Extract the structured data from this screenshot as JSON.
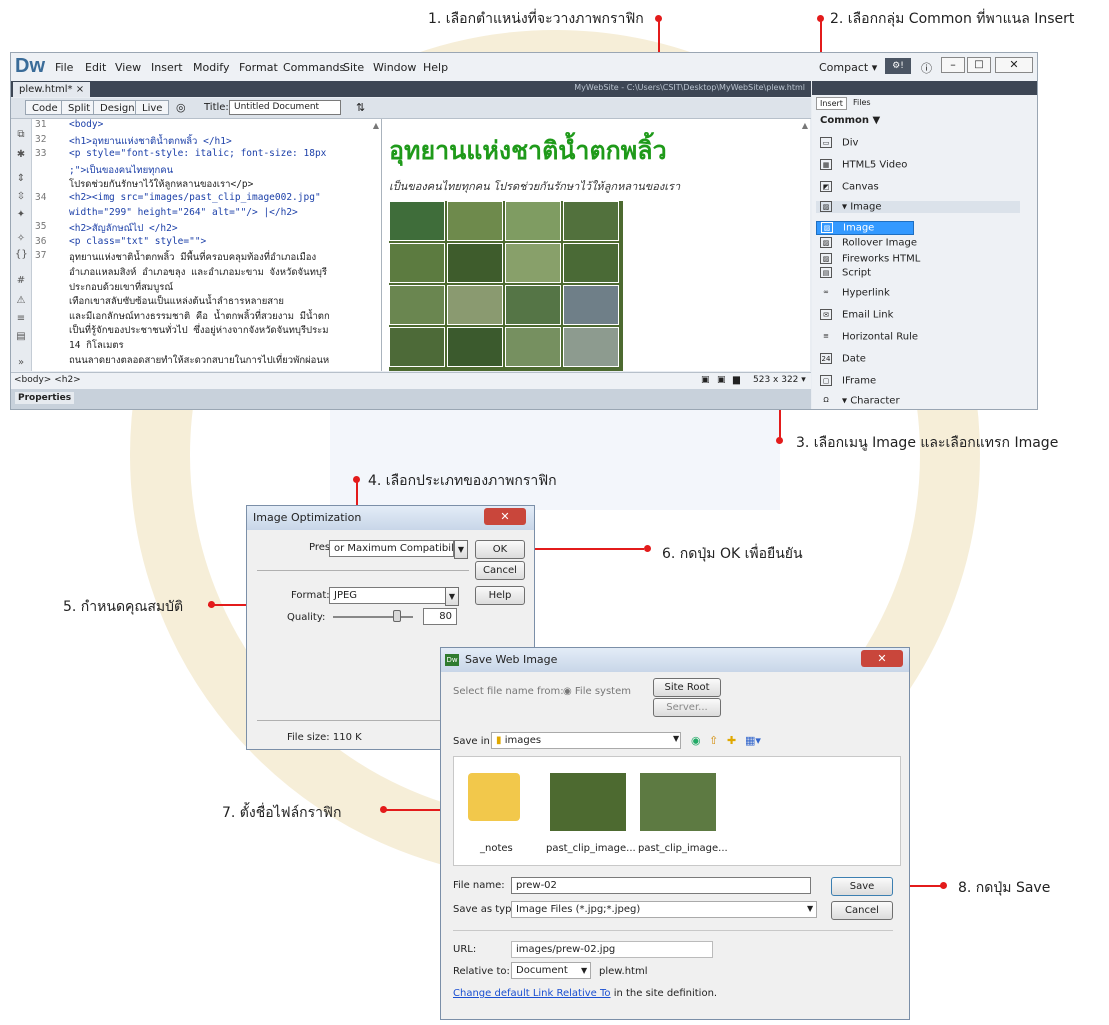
{
  "annotations": {
    "a1": "1. เลือกตำแหน่งที่จะวางภาพกราฟิก",
    "a2": "2. เลือกกลุ่ม Common ที่พาแนล Insert",
    "a3": "3. เลือกเมนู Image และเลือกแทรก Image",
    "a4": "4. เลือกประเภทของภาพกราฟิก",
    "a5": "5. กำหนดคุณสมบัติ",
    "a6": "6. กดปุ่ม OK เพื่อยืนยัน",
    "a7": "7. ตั้งชื่อไฟล์กราฟิก",
    "a8": "8. กดปุ่ม Save"
  },
  "dw": {
    "logo": "Dw",
    "menus": [
      "File",
      "Edit",
      "View",
      "Insert",
      "Modify",
      "Format",
      "Commands",
      "Site",
      "Window",
      "Help"
    ],
    "workspace": "Compact",
    "doc_tab": "plew.html*",
    "path": "MyWebSite - C:\\Users\\CSIT\\Desktop\\MyWebSite\\plew.html",
    "toolbar": {
      "code": "Code",
      "split": "Split",
      "design": "Design",
      "live": "Live",
      "title_label": "Title:",
      "title_value": "Untitled Document"
    },
    "code_lines": [
      {
        "n": "31",
        "t": "<body>"
      },
      {
        "n": "32",
        "t": "<h1>อุทยานแห่งชาติน้ำตกพลิ้ว  </h1>"
      },
      {
        "n": "33",
        "t": "<p style=\"font-style: italic; font-size: 18px"
      },
      {
        "n": "",
        "t": ";\">เป็นของคนไทยทุกคน"
      },
      {
        "n": "",
        "t": "โปรดช่วยกันรักษาไว้ให้ลูกหลานของเรา</p>"
      },
      {
        "n": "34",
        "t": "<h2><img src=\"images/past_clip_image002.jpg\""
      },
      {
        "n": "",
        "t": "width=\"299\" height=\"264\"  alt=\"\"/> |</h2>"
      },
      {
        "n": "35",
        "t": "<h2>สัญลักษณ์ไป </h2>"
      },
      {
        "n": "36",
        "t": "<p class=\"txt\" style=\"\">"
      },
      {
        "n": "37",
        "t": "อุทยานแห่งชาติน้ำตกพลิ้ว มีพื้นที่ครอบคลุมท้องที่อำเภอเมือง"
      },
      {
        "n": "",
        "t": "อำเภอแหลมสิงห์ อำเภอขลุง และอำเภอมะขาม จังหวัดจันทบุรี"
      },
      {
        "n": "",
        "t": "ประกอบด้วยเขาที่สมบูรณ์"
      },
      {
        "n": "",
        "t": "เทือกเขาสลับซับซ้อนเป็นแหล่งต้นน้ำลำธารหลายสาย"
      },
      {
        "n": "",
        "t": "และมีเอกลักษณ์ทางธรรมชาติ คือ น้ำตกพลิ้วที่สวยงาม มีน้ำตก"
      },
      {
        "n": "",
        "t": "เป็นที่รู้จักของประชาชนทั่วไป ซึ่งอยู่ห่างจากจังหวัดจันทบุรีประม"
      },
      {
        "n": "",
        "t": "14 กิโลเมตร"
      },
      {
        "n": "",
        "t": "ถนนลาดยางตลอดสายทำให้สะดวกสบายในการไปเที่ยวพักผ่อนห"
      }
    ],
    "design": {
      "heading": "อุทยานแห่งชาติน้ำตกพลิ้ว",
      "subtitle": "เป็นของคนไทยทุกคน โปรดช่วยกันรักษาไว้ให้ลูกหลานของเรา"
    },
    "status": {
      "tags": "<body> <h2>",
      "size": "523 x 322"
    },
    "properties": "Properties",
    "insert_panel": {
      "tabs": [
        "Insert",
        "Files"
      ],
      "category": "Common",
      "items": [
        "Div",
        "HTML5 Video",
        "Canvas",
        "Image",
        "Image",
        "Rollover Image",
        "Fireworks HTML",
        "Script",
        "Hyperlink",
        "Email Link",
        "Horizontal Rule",
        "Date",
        "IFrame",
        "Character"
      ]
    }
  },
  "image_opt": {
    "title": "Image Optimization",
    "preset_label": "Preset:",
    "preset_value": "or Maximum Compatibility",
    "ok": "OK",
    "cancel": "Cancel",
    "help": "Help",
    "format_label": "Format:",
    "format_value": "JPEG",
    "quality_label": "Quality:",
    "quality_value": "80",
    "quality_fraction": 0.8,
    "file_size": "File size: 110 K"
  },
  "save_dlg": {
    "title": "Save Web Image",
    "select_from": "Select file name from:",
    "file_system": "File system",
    "site_root": "Site Root",
    "server": "Server...",
    "save_in_label": "Save in:",
    "save_in_value": "images",
    "files": [
      "_notes",
      "past_clip_image...",
      "past_clip_image..."
    ],
    "file_name_label": "File name:",
    "file_name_value": "prew-02",
    "save_as_label": "Save as type:",
    "save_as_value": "Image Files (*.jpg;*.jpeg)",
    "save": "Save",
    "cancel": "Cancel",
    "url_label": "URL:",
    "url_value": "images/prew-02.jpg",
    "relative_label": "Relative to:",
    "relative_value": "Document",
    "relative_file": "plew.html",
    "link_text": "Change default Link Relative To",
    "link_suffix": " in the site definition."
  }
}
